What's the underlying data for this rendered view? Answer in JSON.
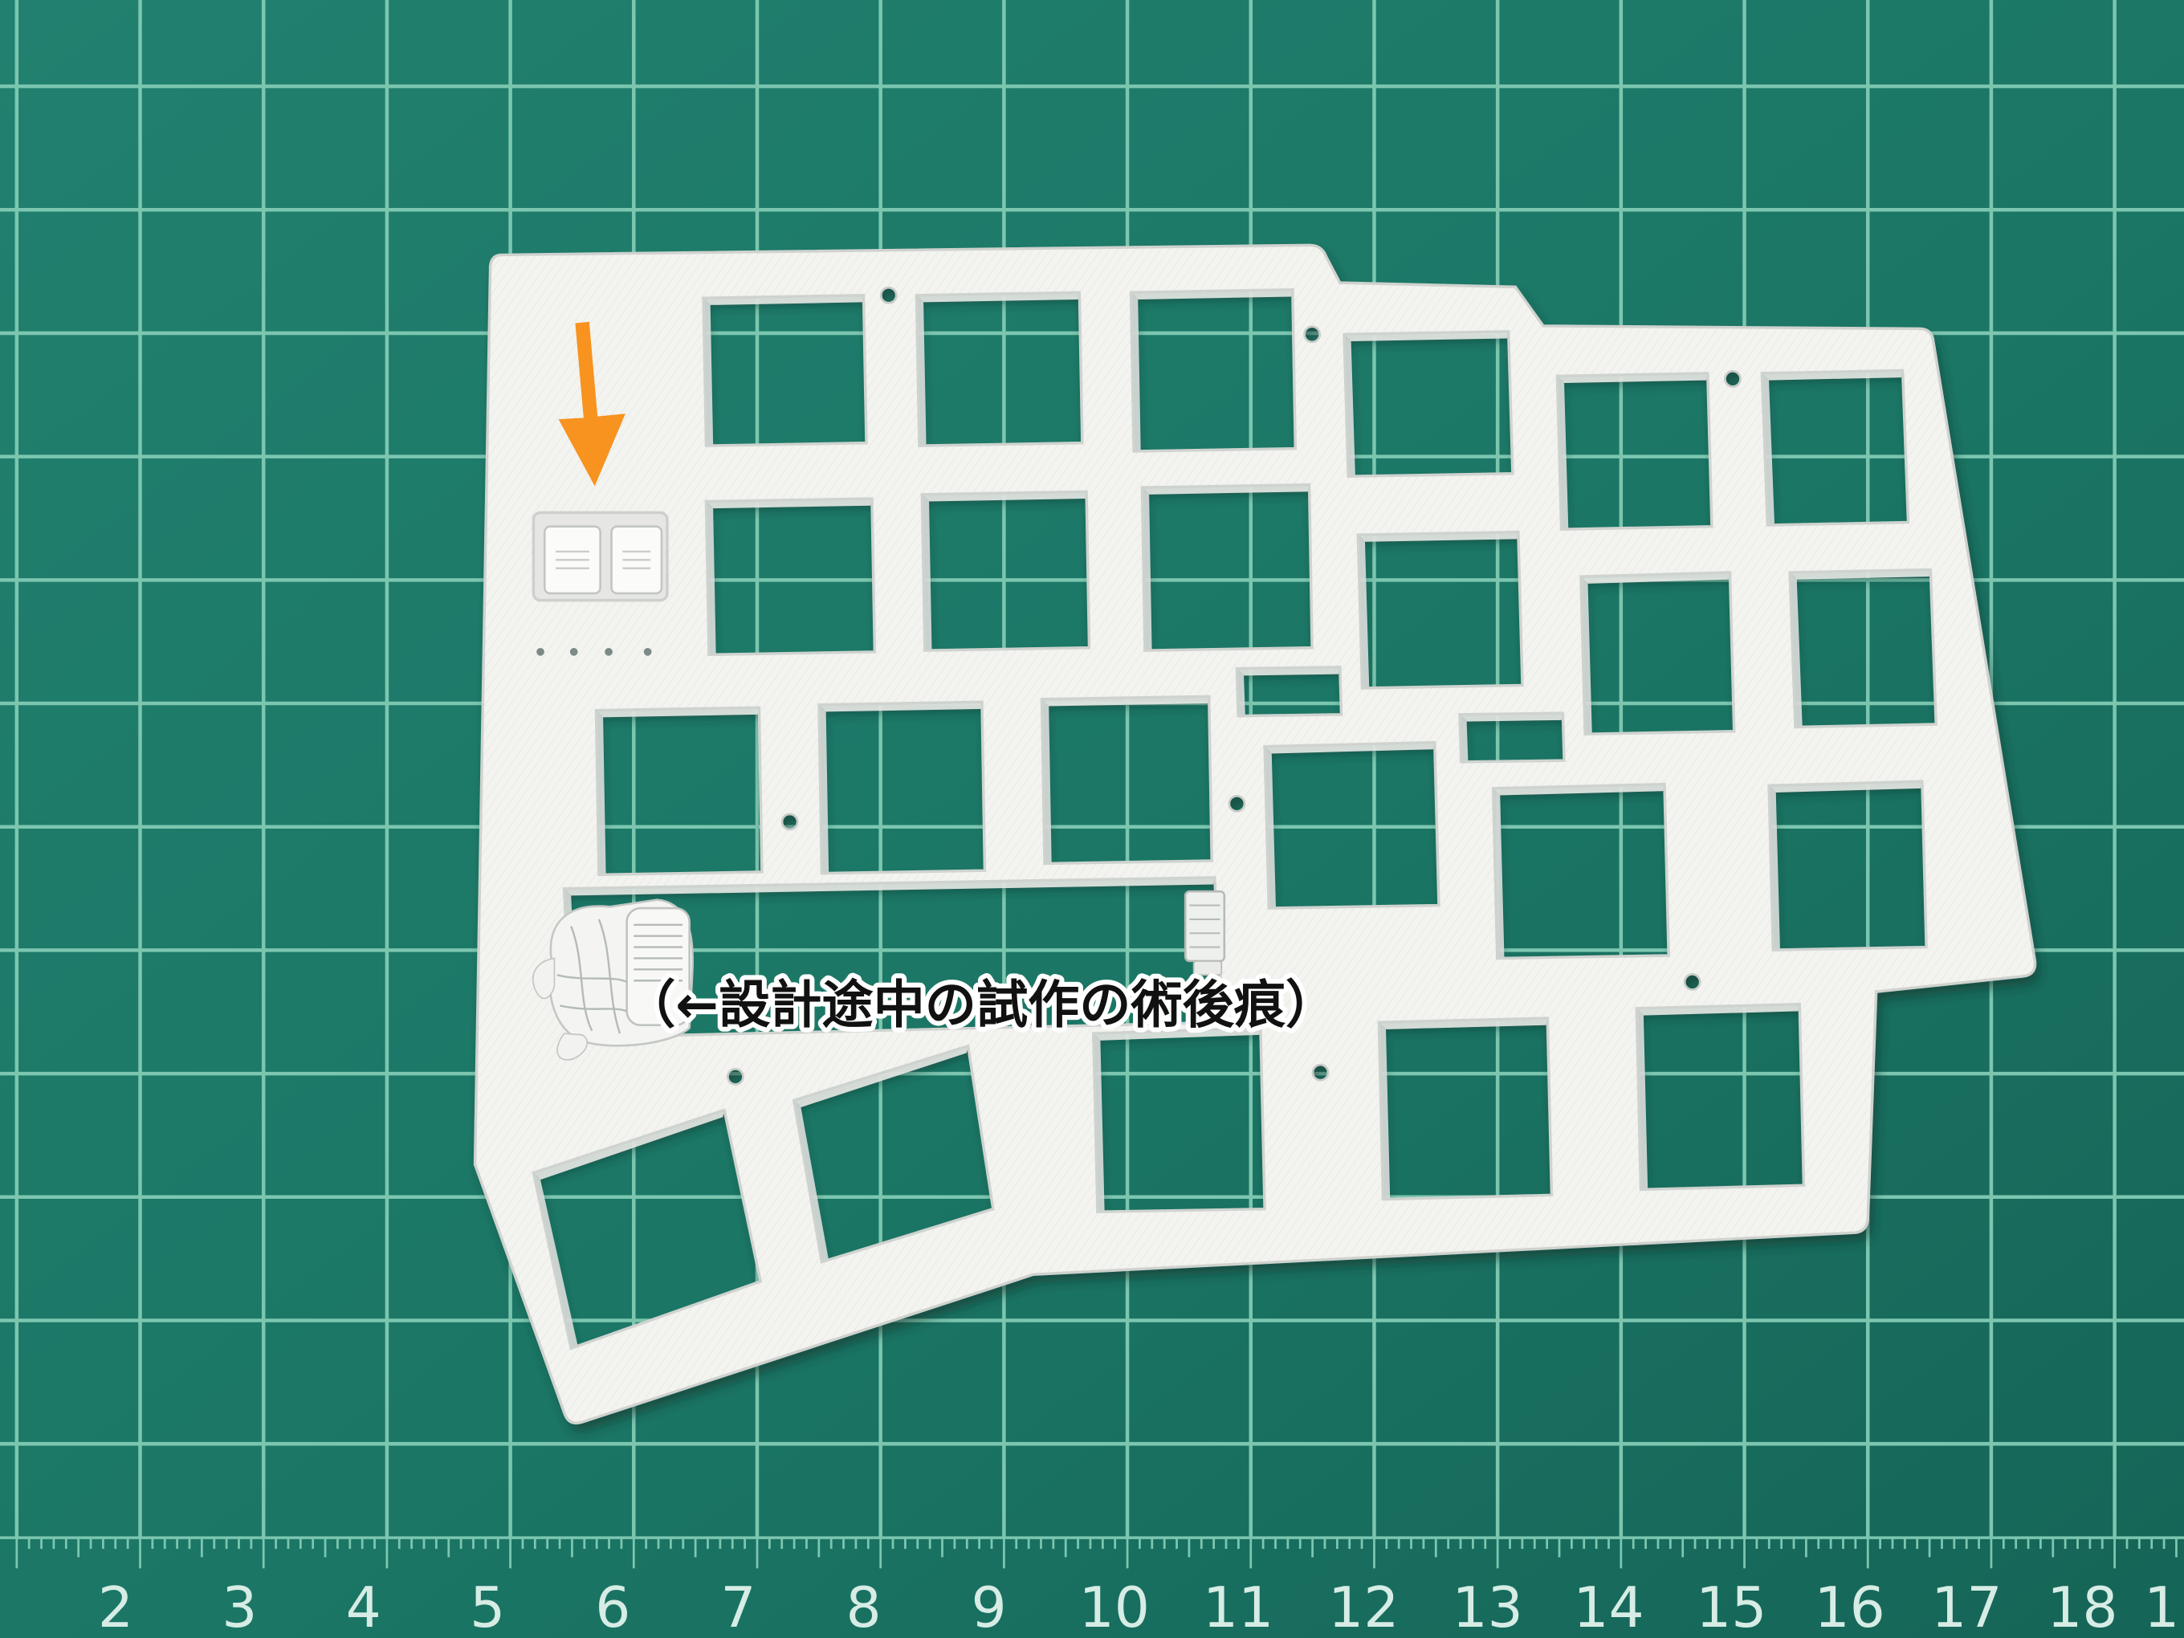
{
  "photo": {
    "annotation_text": "（←設計途中の試作の術後痕）",
    "ruler_labels": [
      "2",
      "3",
      "4",
      "5",
      "6",
      "7",
      "8",
      "9",
      "10",
      "11",
      "12",
      "13",
      "14",
      "15",
      "16",
      "17",
      "18",
      "1"
    ],
    "arrow_icon": "arrow-down-icon",
    "colors": {
      "mat": "#1b7665",
      "grid_line": "#7cc6b0",
      "plate": "#f3f3f0",
      "arrow": "#f7931e",
      "annotation_text": "#111111",
      "ruler_text": "#d6ece5"
    }
  }
}
